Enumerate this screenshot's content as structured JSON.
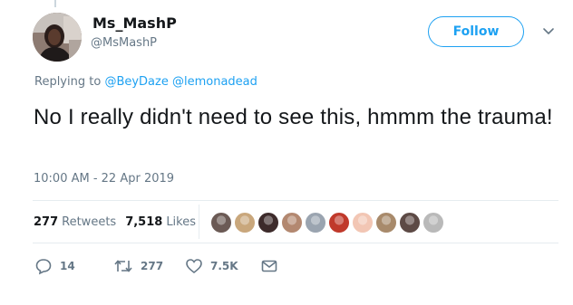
{
  "tweet": {
    "author": {
      "display_name": "Ms_MashP",
      "handle": "@MsMashP"
    },
    "follow_label": "Follow",
    "replying_to_prefix": "Replying to",
    "replying_to": [
      "@BeyDaze",
      "@lemonadead"
    ],
    "text": "No I really didn't need to see this, hmmm the trauma!",
    "timestamp": "10:00 AM - 22 Apr 2019",
    "stats": {
      "retweets_count": "277",
      "retweets_label": "Retweets",
      "likes_count": "7,518",
      "likes_label": "Likes"
    },
    "likers": [
      {
        "name": "liker-avatar-1",
        "color": "#6b5a55"
      },
      {
        "name": "liker-avatar-2",
        "color": "#c9a77c"
      },
      {
        "name": "liker-avatar-3",
        "color": "#3d2b2b"
      },
      {
        "name": "liker-avatar-4",
        "color": "#b38870"
      },
      {
        "name": "liker-avatar-5",
        "color": "#9aa4b0"
      },
      {
        "name": "liker-avatar-6",
        "color": "#c0392b"
      },
      {
        "name": "liker-avatar-7",
        "color": "#f2c6b4"
      },
      {
        "name": "liker-avatar-8",
        "color": "#a88a6b"
      },
      {
        "name": "liker-avatar-9",
        "color": "#5d4a45"
      },
      {
        "name": "liker-avatar-10",
        "color": "#b9b9b9"
      }
    ],
    "actions": {
      "reply_count": "14",
      "retweet_count": "277",
      "like_count": "7.5K"
    },
    "colors": {
      "accent": "#1da1f2",
      "secondary_text": "#657786",
      "primary_text": "#14171a",
      "divider": "#e6ecf0"
    }
  }
}
